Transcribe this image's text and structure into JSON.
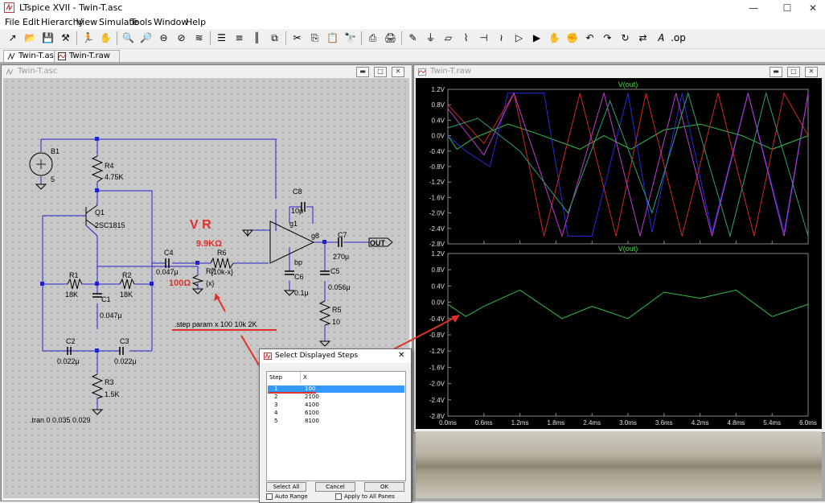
{
  "app": {
    "title": "LTspice XVII - Twin-T.asc"
  },
  "window_controls": {
    "minimize": "—",
    "maximize": "☐",
    "close": "✕"
  },
  "menu": [
    "File",
    "Edit",
    "Hierarchy",
    "View",
    "Simulate",
    "Tools",
    "Window",
    "Help"
  ],
  "toolbar_icons": [
    "new-schematic-icon",
    "open-icon",
    "save-icon",
    "control-panel-icon",
    "run-icon",
    "halt-icon",
    "zoom-in-icon",
    "zoom-pan-icon",
    "zoom-out-icon",
    "zoom-cancel-icon",
    "autorange-icon",
    "view-spice-error-icon",
    "tile-horizontal-icon",
    "tile-vertical-icon",
    "cascade-icon",
    "cut-icon",
    "copy-icon",
    "paste-icon",
    "find-icon",
    "print-icon",
    "print-preview-icon",
    "wire-icon",
    "ground-icon",
    "label-net-icon",
    "resistor-icon",
    "capacitor-icon",
    "inductor-icon",
    "diode-icon",
    "component-icon",
    "move-icon",
    "drag-icon",
    "undo-icon",
    "redo-icon",
    "rotate-icon",
    "mirror-icon",
    "text-icon",
    "spice-directive-icon"
  ],
  "tabs": [
    {
      "label": "Twin-T.asc"
    },
    {
      "label": "Twin-T.raw"
    }
  ],
  "schematic_window": {
    "title": "Twin-T.asc"
  },
  "waveform_window": {
    "title": "Twin-T.raw"
  },
  "schematic": {
    "labels": {
      "b1": "B1",
      "b1_val": "5",
      "r4": "R4",
      "r4_val": "4.75K",
      "q1": "Q1",
      "q1_val": "2SC1815",
      "r1": "R1",
      "r1_val": "18K",
      "r2": "R2",
      "r2_val": "18K",
      "c1": "C1",
      "c1_val": "0.047μ",
      "c2": "C2",
      "c2_val": "0.022μ",
      "c3": "C3",
      "c3_val": "0.022μ",
      "r3": "R3",
      "r3_val": "1.5K",
      "c4": "C4",
      "c4_val": "0.047μ",
      "r6": "R6",
      "r6_val": "{10k-x}",
      "r7": "R7",
      "r7_val": "{x}",
      "c8": "C8",
      "c8_val": "10μ",
      "g1": "g1",
      "g8": "g8",
      "bp": "bp",
      "c6": "C6",
      "c6_val": "0.1μ",
      "c5": "C5",
      "c5_val": "0.056μ",
      "r5": "R5",
      "r5_val": "10",
      "c7": "C7",
      "c7_val": "270μ",
      "out": "OUT",
      "directive_step": ".step param x 100 10k 2K",
      "directive_tran": ".tran 0 0.035 0.029"
    },
    "annotations": {
      "vr": "V R",
      "vr_max": "9.9KΩ",
      "vr_min": "100Ω"
    },
    "annotation_color": "#e0302a"
  },
  "plot": {
    "pane1_title": "V(out)",
    "pane2_title": "V(out)",
    "y_ticks": [
      "1.2V",
      "0.8V",
      "0.4V",
      "0.0V",
      "-0.4V",
      "-0.8V",
      "-1.2V",
      "-1.6V",
      "-2.0V",
      "-2.4V",
      "-2.8V"
    ],
    "x_ticks": [
      "0.0ms",
      "0.6ms",
      "1.2ms",
      "1.8ms",
      "2.4ms",
      "3.0ms",
      "3.6ms",
      "4.2ms",
      "4.8ms",
      "5.4ms",
      "6.0ms"
    ],
    "series_colors": [
      "#2fbf4a",
      "#2a2adf",
      "#d02828",
      "#c03ad0",
      "#2fa07a"
    ],
    "label_color": "#e0e0e0",
    "title_color": "#3fdf3f"
  },
  "chart_data": {
    "type": "line",
    "title": "V(out)",
    "xlabel": "",
    "ylabel": "",
    "xlim": [
      0,
      6.0
    ],
    "ylim": [
      -2.8,
      1.2
    ],
    "series": [
      {
        "name": "step 1 (x=100)",
        "x": [
          0,
          0.15,
          0.45,
          1.0,
          1.4,
          2.2,
          2.6,
          3.05,
          3.6,
          4.2,
          4.9,
          5.4,
          6.0
        ],
        "values": [
          0.0,
          -0.35,
          -0.05,
          0.3,
          0.1,
          -0.35,
          0.0,
          -0.35,
          0.15,
          0.3,
          0.0,
          -0.35,
          0.0
        ]
      },
      {
        "name": "step 2 (x=2100)",
        "x": [
          0,
          0.3,
          0.7,
          1.0,
          1.6,
          2.0,
          2.4,
          3.0,
          3.4,
          3.9,
          4.4,
          5.0,
          5.6,
          6.0
        ],
        "values": [
          0.0,
          -0.4,
          -0.8,
          1.1,
          1.1,
          -2.6,
          -2.6,
          1.1,
          -2.5,
          1.1,
          -2.5,
          1.1,
          -2.5,
          1.1
        ]
      },
      {
        "name": "step 3 (x=4100)",
        "x": [
          0,
          0.6,
          1.1,
          1.6,
          2.2,
          2.8,
          3.3,
          3.9,
          4.5,
          5.1,
          5.6,
          6.0
        ],
        "values": [
          0.8,
          -0.2,
          1.1,
          -2.6,
          1.1,
          -2.6,
          1.1,
          -2.6,
          1.1,
          -2.6,
          1.1,
          0.0
        ]
      },
      {
        "name": "step 4 (x=6100)",
        "x": [
          0,
          0.6,
          1.1,
          1.9,
          2.6,
          3.2,
          3.8,
          4.4,
          5.0,
          5.6,
          6.0
        ],
        "values": [
          0.7,
          -0.5,
          1.1,
          -2.6,
          1.1,
          -2.6,
          1.1,
          -2.6,
          1.1,
          -2.6,
          1.1
        ]
      },
      {
        "name": "step 5 (x=8100)",
        "x": [
          0,
          0.5,
          1.2,
          2.0,
          2.7,
          3.4,
          4.0,
          4.7,
          5.3,
          6.0
        ],
        "values": [
          0.2,
          0.45,
          -0.4,
          -2.0,
          0.9,
          -2.0,
          1.1,
          -2.6,
          1.1,
          -2.6
        ]
      }
    ],
    "pane2": {
      "x": [
        0,
        0.3,
        0.6,
        1.2,
        1.9,
        2.4,
        3.0,
        3.6,
        4.2,
        4.8,
        5.4,
        6.0
      ],
      "values": [
        -0.05,
        -0.35,
        -0.1,
        0.3,
        -0.4,
        -0.1,
        -0.4,
        0.25,
        0.1,
        0.3,
        -0.35,
        -0.05
      ]
    },
    "x_unit": "ms",
    "y_unit": "V"
  },
  "dialog": {
    "title": "Select Displayed Steps",
    "close": "✕",
    "col_step": "Step",
    "col_x": "X",
    "rows": [
      {
        "step": "1",
        "x": "100"
      },
      {
        "step": "2",
        "x": "2100"
      },
      {
        "step": "3",
        "x": "4100"
      },
      {
        "step": "4",
        "x": "6100"
      },
      {
        "step": "5",
        "x": "8100"
      }
    ],
    "buttons": {
      "select_all": "Select All",
      "cancel": "Cancel",
      "ok": "OK"
    },
    "checks": {
      "auto_range": "Auto Range",
      "apply_all": "Apply to All Panes"
    }
  }
}
